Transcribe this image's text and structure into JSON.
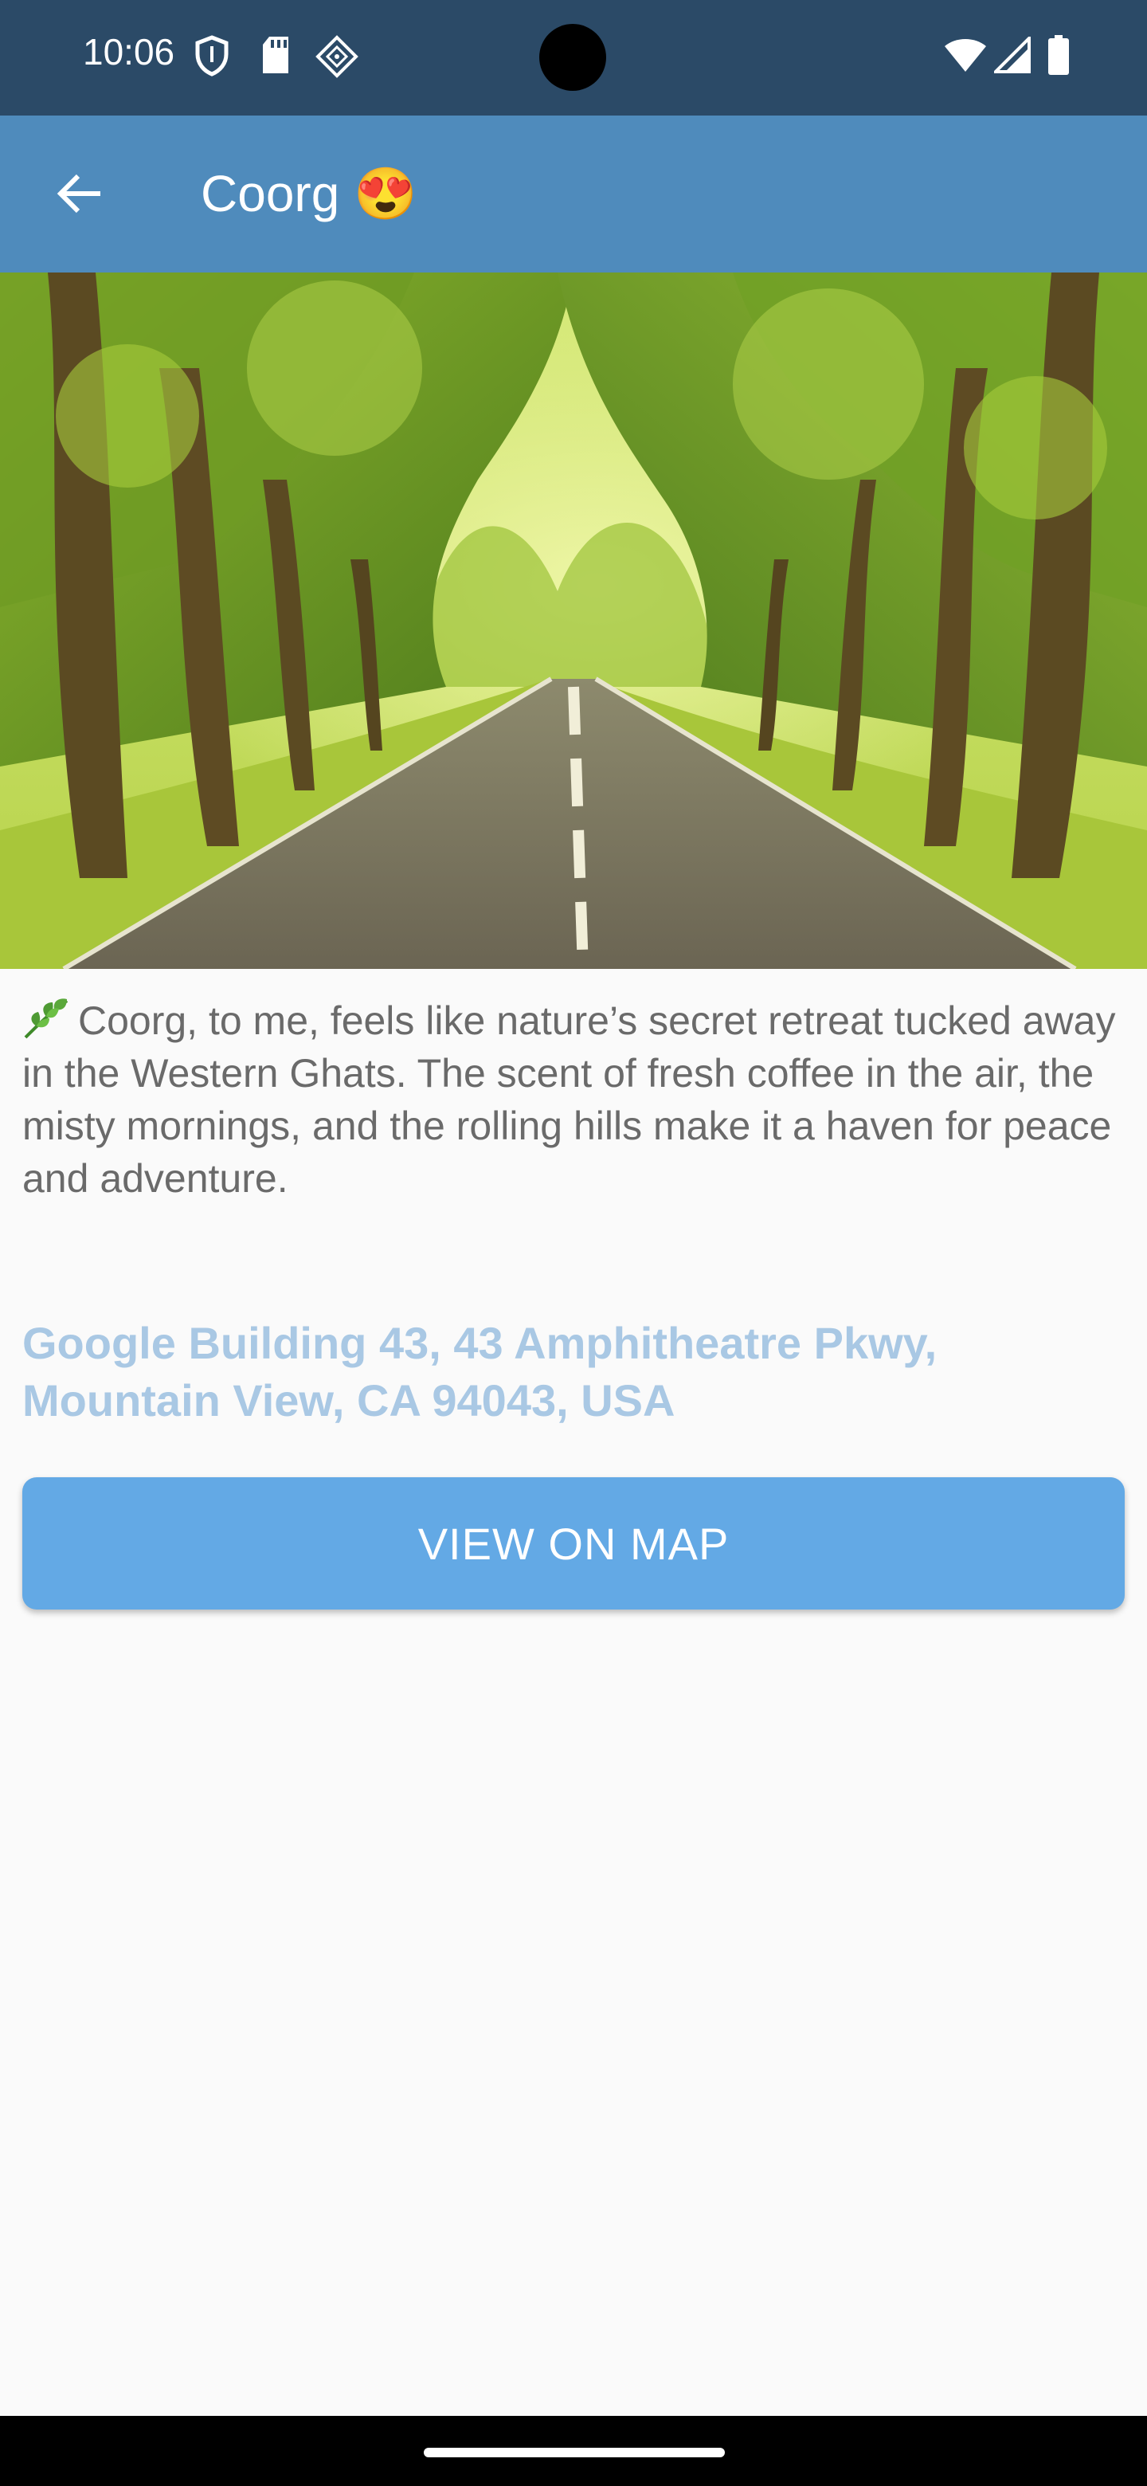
{
  "status_bar": {
    "time": "10:06",
    "icons": [
      "shield-icon",
      "sd-card-icon",
      "app-notification-icon",
      "wifi-icon",
      "cell-signal-icon",
      "battery-icon"
    ]
  },
  "app_bar": {
    "back_icon": "arrow-back-icon",
    "title": "Coorg 😍"
  },
  "hero": {
    "image": "tree-lined-road-photo"
  },
  "content": {
    "description": "Coorg, to me, feels like nature’s secret retreat tucked away in the Western Ghats. The scent of fresh coffee in the air, the misty mornings, and the rolling hills make it a haven for peace and adventure.",
    "leaf_icon": "herb-icon",
    "address": "Google Building 43, 43 Amphitheatre Pkwy, Mountain View, CA 94043, USA",
    "map_button_label": "VIEW ON MAP"
  },
  "colors": {
    "status_bar": "#2b4a67",
    "app_bar": "#4f8bbc",
    "button": "#63a9e5",
    "address_text": "#a9c8e4",
    "body_text": "#6a6a6a"
  }
}
